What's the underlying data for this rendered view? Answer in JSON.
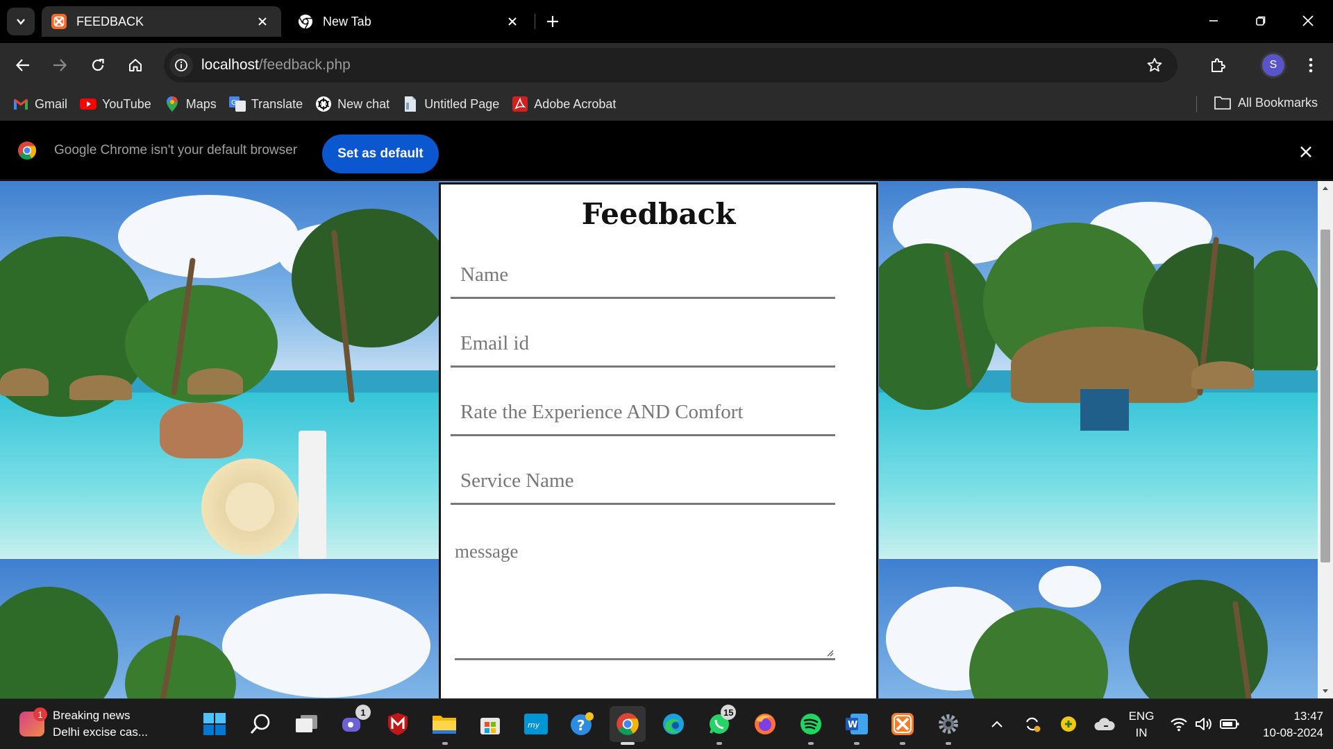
{
  "browser": {
    "tabs": [
      {
        "title": "FEEDBACK",
        "active": true,
        "favicon": "xampp-icon"
      },
      {
        "title": "New Tab",
        "active": false,
        "favicon": "chrome-icon"
      }
    ],
    "url_host": "localhost",
    "url_path": "/feedback.php",
    "profile_initial": "S",
    "bookmarks": [
      {
        "label": "Gmail",
        "icon": "gmail-icon"
      },
      {
        "label": "YouTube",
        "icon": "youtube-icon"
      },
      {
        "label": "Maps",
        "icon": "maps-icon"
      },
      {
        "label": "Translate",
        "icon": "translate-icon"
      },
      {
        "label": "New chat",
        "icon": "chatgpt-icon"
      },
      {
        "label": "Untitled Page",
        "icon": "page-icon"
      },
      {
        "label": "Adobe Acrobat",
        "icon": "acrobat-icon"
      }
    ],
    "all_bookmarks": "All Bookmarks",
    "infobar_message": "Google Chrome isn't your default browser",
    "set_default_label": "Set as default"
  },
  "page": {
    "title": "Feedback",
    "fields": {
      "name_placeholder": "Name",
      "email_placeholder": "Email id",
      "rate_placeholder": "Rate the Experience AND Comfort",
      "service_placeholder": "Service Name",
      "message_placeholder": "message"
    }
  },
  "taskbar": {
    "news_title": "Breaking news",
    "news_subtitle": "Delhi excise cas...",
    "news_badge": "1",
    "teams_badge": "1",
    "whatsapp_badge": "15",
    "lang_top": "ENG",
    "lang_bottom": "IN",
    "time": "13:47",
    "date": "10-08-2024"
  },
  "colors": {
    "accent_blue": "#0b57d0",
    "avatar": "#5a54c9",
    "toolbar": "#2b2b2b"
  }
}
